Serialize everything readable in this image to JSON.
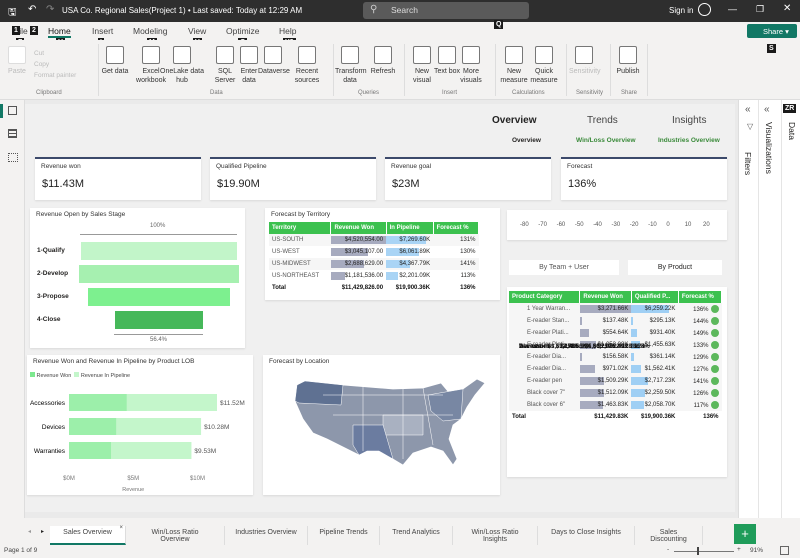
{
  "titlebar": {
    "title": "USA Co. Regional Sales(Project 1) • Last saved: Today at 12:29 AM",
    "search": "Search",
    "sign_in": "Sign in",
    "share": "Share"
  },
  "keytips": {
    "file1": "1",
    "file2": "2",
    "f": "F",
    "h": "H",
    "i": "I",
    "m": "M",
    "v": "V",
    "o": "O",
    "y2": "Y2",
    "q": "Q",
    "s": "S",
    "zr": "ZR"
  },
  "ribbon_tabs": [
    "File",
    "Home",
    "Insert",
    "Modeling",
    "View",
    "Optimize",
    "Help"
  ],
  "ribbon": {
    "clipboard": {
      "paste": "Paste",
      "cut": "Cut",
      "copy": "Copy",
      "format_painter": "Format painter",
      "group": "Clipboard"
    },
    "data": {
      "items": [
        "Get data",
        "Excel workbook",
        "OneLake data hub",
        "SQL Server",
        "Enter data",
        "Dataverse",
        "Recent sources"
      ],
      "group": "Data"
    },
    "queries": {
      "items": [
        "Transform data",
        "Refresh"
      ],
      "group": "Queries"
    },
    "insert": {
      "items": [
        "New visual",
        "Text box",
        "More visuals"
      ],
      "group": "Insert"
    },
    "calculations": {
      "items": [
        "New measure",
        "Quick measure"
      ],
      "group": "Calculations"
    },
    "sensitivity": {
      "items": [
        "Sensitivity"
      ],
      "group": "Sensitivity"
    },
    "share": {
      "items": [
        "Publish"
      ],
      "group": "Share"
    }
  },
  "nav": {
    "sections": [
      "Overview",
      "Trends",
      "Insights"
    ],
    "sub": [
      "Overview",
      "Win/Loss Overview",
      "Industries Overview"
    ]
  },
  "cards": [
    {
      "label": "Revenue won",
      "value": "$11.43M"
    },
    {
      "label": "Qualified Pipeline",
      "value": "$19.90M"
    },
    {
      "label": "Revenue goal",
      "value": "$23M"
    },
    {
      "label": "Forecast",
      "value": "136%"
    }
  ],
  "funnel": {
    "title": "Revenue Open by Sales Stage",
    "top_label": "100%",
    "bottom_label": "56.4%",
    "stages": [
      {
        "name": "1-Qualify",
        "value": 100
      },
      {
        "name": "2-Develop",
        "value": 102
      },
      {
        "name": "3-Propose",
        "value": 90
      },
      {
        "name": "4-Close",
        "value": 56.4
      }
    ]
  },
  "territory": {
    "title": "Forecast by Territory",
    "headers": [
      "Territory",
      "Revenue Won",
      "In Pipeline",
      "Forecast %"
    ],
    "rows": [
      [
        "US-SOUTH",
        "$4,520,554.00",
        "$7,269.60K",
        "131%"
      ],
      [
        "US-WEST",
        "$3,045,107.00",
        "$6,061.89K",
        "130%"
      ],
      [
        "US-MIDWEST",
        "$2,688,629.00",
        "$4,367.79K",
        "141%"
      ],
      [
        "US-NORTHEAST",
        "$1,181,536.00",
        "$2,201.09K",
        "113%"
      ]
    ],
    "total": [
      "Total",
      "$11,429,826.00",
      "$19,900.36K",
      "136%"
    ]
  },
  "gauge_axis": [
    "-80",
    "-70",
    "-60",
    "-50",
    "-40",
    "-30",
    "-20",
    "-10",
    "0",
    "10",
    "20"
  ],
  "toggle": {
    "team": "By Team + User",
    "product": "By Product"
  },
  "product": {
    "headers": [
      "Product Category",
      "Revenue Won",
      "Qualified P...",
      "Forecast %"
    ],
    "rows": [
      {
        "g": true,
        "c": [
          "Warranties",
          "$3,271.66K",
          "$6,259.22K",
          "136%"
        ]
      },
      {
        "c": [
          "1 Year Warran...",
          "$3,271.66K",
          "$6,259.22K",
          "136%"
        ],
        "w": 1,
        "p": 1
      },
      {
        "g": true,
        "c": [
          "Devices",
          "$3,672.98K",
          "$6,605.71K",
          "128%"
        ]
      },
      {
        "c": [
          "E-reader Stan...",
          "$137.48K",
          "$295.13K",
          "144%"
        ],
        "w": 0.04,
        "p": 0.05
      },
      {
        "c": [
          "E-reader Plati...",
          "$554.64K",
          "$931.40K",
          "149%"
        ],
        "w": 0.17,
        "p": 0.15
      },
      {
        "c": [
          "E-reader Plati...",
          "$1,053.08K",
          "$1,455.63K",
          "133%"
        ],
        "w": 0.32,
        "p": 0.23
      },
      {
        "c": [
          "E-reader Dia...",
          "$156.58K",
          "$361.14K",
          "129%"
        ],
        "w": 0.05,
        "p": 0.06
      },
      {
        "c": [
          "E-reader Dia...",
          "$971.02K",
          "$1,562.41K",
          "127%"
        ],
        "w": 0.3,
        "p": 0.25
      },
      {
        "g": true,
        "c": [
          "Accessories",
          "$4,485.19K",
          "$7,035.43K",
          "128%"
        ]
      },
      {
        "c": [
          "E-reader pen",
          "$1,509.29K",
          "$2,717.23K",
          "141%"
        ],
        "w": 0.46,
        "p": 0.43
      },
      {
        "c": [
          "Black cover 7\"",
          "$1,512.09K",
          "$2,259.50K",
          "126%"
        ],
        "w": 0.46,
        "p": 0.36
      },
      {
        "c": [
          "Black cover 6\"",
          "$1,463.83K",
          "$2,058.70K",
          "117%"
        ],
        "w": 0.45,
        "p": 0.33
      }
    ],
    "total": [
      "Total",
      "$11,429.83K",
      "$19,900.36K",
      "136%"
    ]
  },
  "lob": {
    "title": "Revenue Won and Revenue In Pipeline by Product LOB",
    "legend": [
      "Revenue Won",
      "Revenue In Pipeline"
    ],
    "xlabel": "Revenue",
    "ticks": [
      "$0M",
      "$5M",
      "$10M"
    ],
    "bars": [
      {
        "name": "Accessories",
        "won": 4.49,
        "total": 11.52,
        "label": "$11.52M"
      },
      {
        "name": "Devices",
        "won": 3.67,
        "total": 10.28,
        "label": "$10.28M"
      },
      {
        "name": "Warranties",
        "won": 3.27,
        "total": 9.53,
        "label": "$9.53M"
      }
    ]
  },
  "map": {
    "title": "Forecast by Location"
  },
  "panes": {
    "filters": "Filters",
    "visualizations": "Visualizations",
    "data": "Data"
  },
  "page_tabs": [
    "Sales Overview",
    "Win/Loss Ratio Overview",
    "Industries Overview",
    "Pipeline Trends",
    "Trend Analytics",
    "Win/Loss Ratio Insights",
    "Days to Close Insights",
    "Sales Discounting"
  ],
  "status": {
    "page": "Page 1 of 9",
    "zoom": "91%"
  },
  "colors": {
    "accent": "#3cc14f",
    "won": "#9aa0b8",
    "pipeline": "#8ec7f0",
    "title_bar": "#2e2e2e"
  }
}
